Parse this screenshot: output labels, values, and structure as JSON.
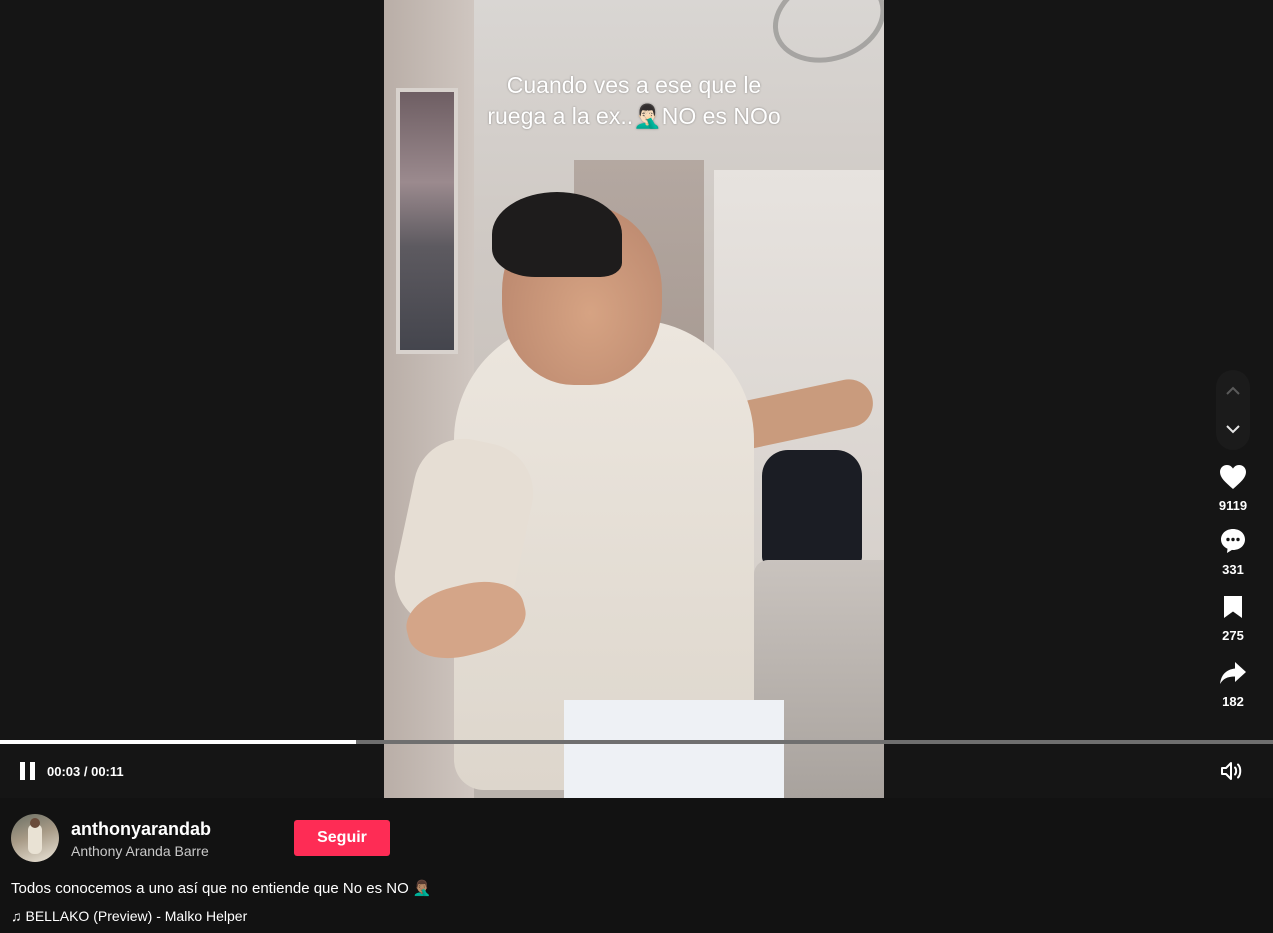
{
  "video": {
    "caption_line1": "Cuando ves a ese que le",
    "caption_line2": "ruega a la ex..🤦🏻‍♂️NO es NOo"
  },
  "actions": {
    "likes": "9119",
    "comments": "331",
    "saves": "275",
    "shares": "182"
  },
  "player": {
    "time": "00:03 / 00:11",
    "progress_fraction": 0.28
  },
  "author": {
    "username": "anthonyarandab",
    "display_name": "Anthony Aranda Barre",
    "follow_label": "Seguir"
  },
  "post": {
    "description": "Todos conocemos a uno así que no entiende que No es NO 🤦🏽‍♂️",
    "music_icon": "♫",
    "music": "BELLAKO (Preview) - Malko Helper"
  },
  "colors": {
    "accent": "#fe2c55",
    "background": "#121212"
  },
  "icons": {
    "nav_up": "chevron-up-icon",
    "nav_down": "chevron-down-icon",
    "like": "heart-icon",
    "comment": "comment-icon",
    "save": "bookmark-icon",
    "share": "share-icon",
    "pause": "pause-icon",
    "volume": "volume-icon",
    "music": "music-note-icon"
  }
}
